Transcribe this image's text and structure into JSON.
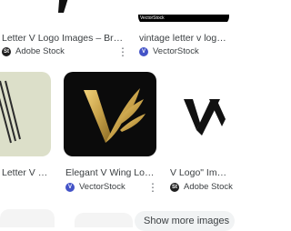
{
  "results": [
    {
      "title": "Letter V Logo Images – Brow...",
      "source": "Adobe Stock",
      "source_icon": "adobe-stock-icon"
    },
    {
      "title": "vintage letter v logo cla",
      "source": "VectorStock",
      "source_icon": "vectorstock-icon",
      "banner_text": "VectorStock"
    },
    {
      "title": "Letter V M...",
      "source": "",
      "source_icon": ""
    },
    {
      "title": "Elegant V Wing Logo...",
      "source": "VectorStock",
      "source_icon": "vectorstock-icon"
    },
    {
      "title": "V Logo\" Image",
      "source": "Adobe Stock",
      "source_icon": "adobe-stock-icon"
    }
  ],
  "more_icon": "⋮",
  "show_more_label": "Show more images",
  "colors": {
    "gold": "#c9a34a",
    "vectorstock": "#4353c7",
    "adobe_black": "#1f1f1f"
  }
}
